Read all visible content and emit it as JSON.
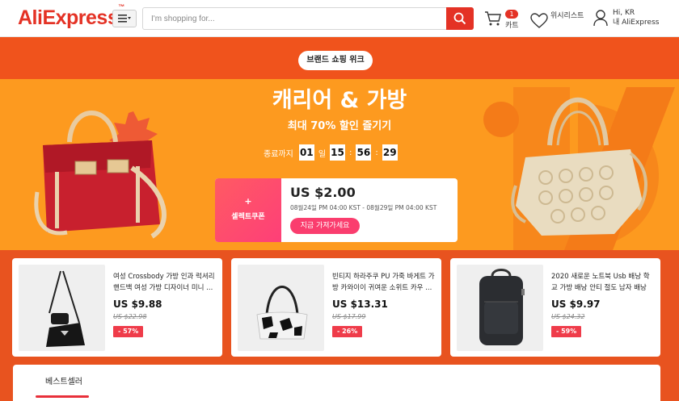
{
  "header": {
    "logo": "AliExpress",
    "logo_tm": "™",
    "search_placeholder": "I'm shopping for...",
    "cart_count": "1",
    "cart_label": "카트",
    "wishlist_label": "위시리스트",
    "account_greeting": "Hi, KR",
    "account_label": "내 AliExpress"
  },
  "banner": {
    "pill": "브랜드 쇼핑 위크",
    "title": "캐리어 & 가방",
    "subtitle": "최대 70% 할인 즐기기",
    "countdown": {
      "label": "종료까지",
      "days": "01",
      "day_unit": "일",
      "hours": "15",
      "sep1": ":",
      "minutes": "56",
      "sep2": ":",
      "seconds": "29"
    },
    "coupon": {
      "plus": "+",
      "type": "셀렉트쿠폰",
      "amount": "US $2.00",
      "date": "08월24일 PM 04:00 KST - 08월29일 PM 04:00 KST",
      "button": "지금 가져가세요"
    }
  },
  "products": [
    {
      "title": "여성 Crossbody 가방 인과 럭셔리 핸드백 여성 가방 디자이너 미니 ...",
      "price": "US $9.88",
      "original": "US $22.98",
      "discount": "- 57%"
    },
    {
      "title": "빈티지 하라주쿠 PU 가죽 바게트 가방 카와이이 귀여운 소위트 카우 ...",
      "price": "US $13.31",
      "original": "US $17.99",
      "discount": "- 26%"
    },
    {
      "title": "2020 새로운 노트북 Usb 배낭 학교 가방 배낭 안티 절도 남자 배낭 여...",
      "price": "US $9.97",
      "original": "US $24.32",
      "discount": "- 59%"
    }
  ],
  "bottom_tab": "베스트셀러",
  "colors": {
    "brand": "#e43225",
    "band": "#f0531c",
    "hero": "#fd9a1f",
    "discount": "#ef3c4a",
    "coupon_button": "#fa3d6e"
  }
}
